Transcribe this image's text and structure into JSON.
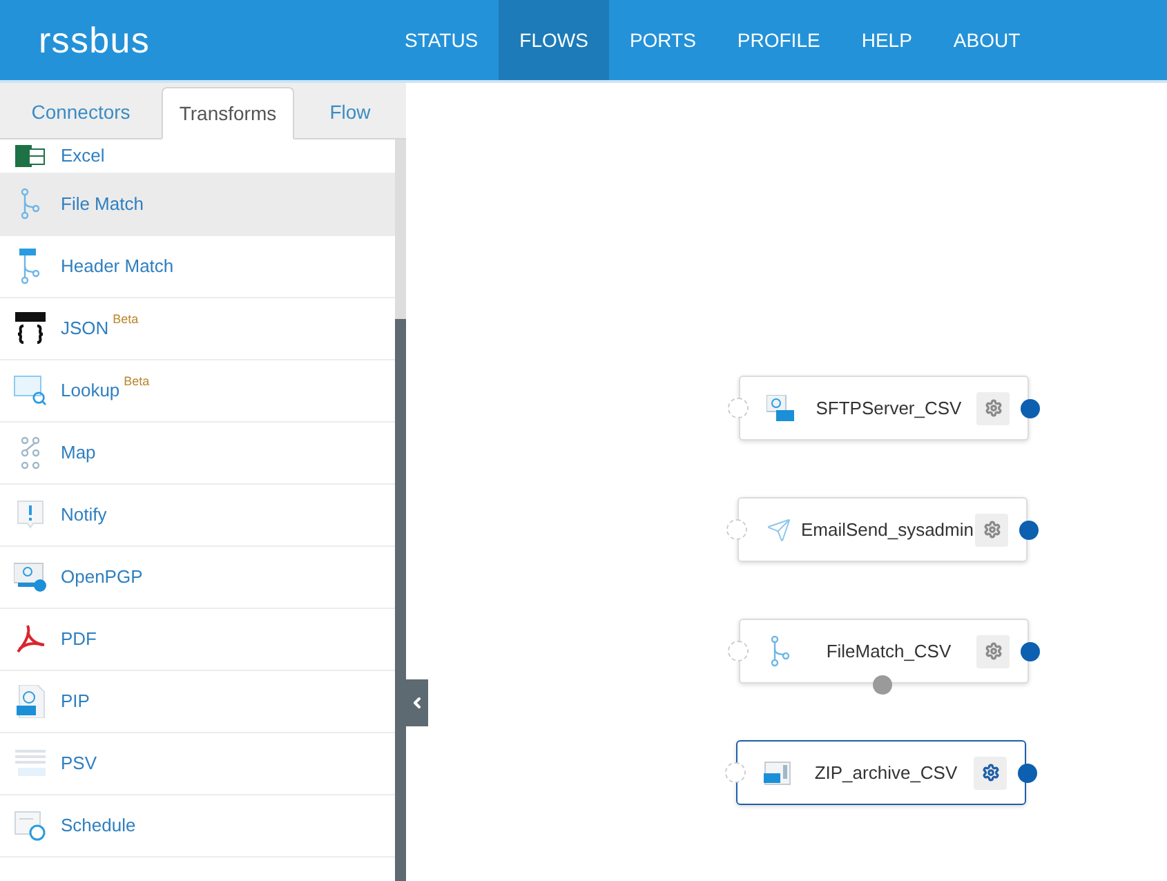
{
  "header": {
    "logo": "rssbus",
    "nav": [
      {
        "label": "STATUS",
        "selected": false
      },
      {
        "label": "FLOWS",
        "selected": true
      },
      {
        "label": "PORTS",
        "selected": false
      },
      {
        "label": "PROFILE",
        "selected": false
      },
      {
        "label": "HELP",
        "selected": false
      },
      {
        "label": "ABOUT",
        "selected": false
      }
    ]
  },
  "sidebar": {
    "tabs": [
      {
        "label": "Connectors",
        "selected": false
      },
      {
        "label": "Transforms",
        "selected": true
      },
      {
        "label": "Flow",
        "selected": false
      }
    ],
    "items": [
      {
        "label": "Excel",
        "kind": "excel",
        "selected": false
      },
      {
        "label": "File Match",
        "kind": "branch",
        "selected": true
      },
      {
        "label": "Header Match",
        "kind": "header",
        "selected": false
      },
      {
        "label": "JSON",
        "badge": "Beta",
        "kind": "json",
        "selected": false
      },
      {
        "label": "Lookup",
        "badge": "Beta",
        "kind": "lookup",
        "selected": false
      },
      {
        "label": "Map",
        "kind": "map",
        "selected": false
      },
      {
        "label": "Notify",
        "kind": "notify",
        "selected": false
      },
      {
        "label": "OpenPGP",
        "kind": "pgp",
        "selected": false
      },
      {
        "label": "PDF",
        "kind": "pdf",
        "selected": false
      },
      {
        "label": "PIP",
        "kind": "pip",
        "selected": false
      },
      {
        "label": "PSV",
        "kind": "psv",
        "selected": false
      },
      {
        "label": "Schedule",
        "kind": "schedule",
        "selected": false
      }
    ]
  },
  "canvas": {
    "nodes": [
      {
        "label": "SFTPServer_CSV",
        "kind": "sftp",
        "selected": false,
        "bottom_port": false
      },
      {
        "label": "EmailSend_sysadmin",
        "kind": "email",
        "selected": false,
        "bottom_port": false
      },
      {
        "label": "FileMatch_CSV",
        "kind": "branch",
        "selected": false,
        "bottom_port": true
      },
      {
        "label": "ZIP_archive_CSV",
        "kind": "zip",
        "selected": true,
        "bottom_port": false
      }
    ]
  }
}
